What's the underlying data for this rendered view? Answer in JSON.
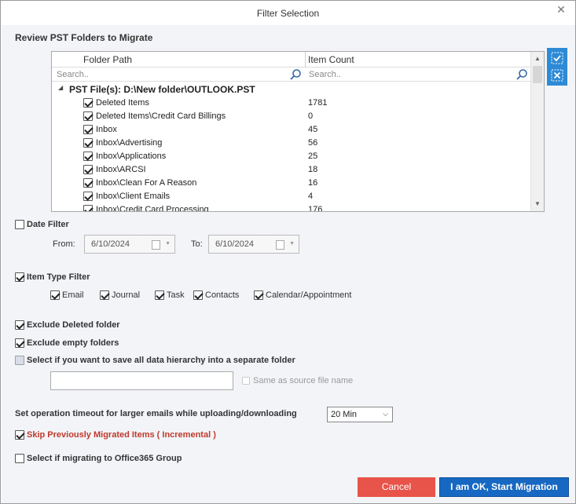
{
  "window": {
    "title": "Filter Selection",
    "close_glyph": "✕"
  },
  "review": {
    "title": "Review PST Folders to Migrate",
    "columns": {
      "path": "Folder Path",
      "count": "Item Count"
    },
    "search_placeholder_path": "Search..",
    "search_placeholder_count": "Search..",
    "group_label": "PST File(s): D:\\New folder\\OUTLOOK.PST",
    "rows": [
      {
        "path": "Deleted Items",
        "count": "1781",
        "checked": true
      },
      {
        "path": "Deleted Items\\Credit Card Billings",
        "count": "0",
        "checked": true
      },
      {
        "path": "Inbox",
        "count": "45",
        "checked": true
      },
      {
        "path": "Inbox\\Advertising",
        "count": "56",
        "checked": true
      },
      {
        "path": "Inbox\\Applications",
        "count": "25",
        "checked": true
      },
      {
        "path": "Inbox\\ARCSI",
        "count": "18",
        "checked": true
      },
      {
        "path": "Inbox\\Clean For A Reason",
        "count": "16",
        "checked": true
      },
      {
        "path": "Inbox\\Client Emails",
        "count": "4",
        "checked": true
      },
      {
        "path": "Inbox\\Credit Card Processing",
        "count": "176",
        "checked": true
      }
    ]
  },
  "date_filter": {
    "label": "Date Filter",
    "checked": false,
    "from_label": "From:",
    "from_value": "6/10/2024",
    "to_label": "To:",
    "to_value": "6/10/2024"
  },
  "item_type_filter": {
    "label": "Item Type Filter",
    "checked": true,
    "types": [
      {
        "label": "Email",
        "checked": true
      },
      {
        "label": "Journal",
        "checked": true
      },
      {
        "label": "Task",
        "checked": true
      },
      {
        "label": "Contacts",
        "checked": true
      },
      {
        "label": "Calendar/Appointment",
        "checked": true
      }
    ]
  },
  "options": {
    "exclude_deleted": {
      "label": "Exclude Deleted folder",
      "checked": true
    },
    "exclude_empty": {
      "label": "Exclude empty folders",
      "checked": true
    },
    "save_hierarchy": {
      "label": "Select if you want to save all data hierarchy into a separate folder",
      "checked": false
    },
    "folder_name_value": "",
    "same_as_source": {
      "label": "Same as source file name",
      "checked": false
    }
  },
  "timeout": {
    "label": "Set operation timeout for larger emails while uploading/downloading",
    "value": "20 Min"
  },
  "skip_migrated": {
    "label": "Skip Previously Migrated Items ( Incremental )",
    "checked": true
  },
  "office365_group": {
    "label": "Select if migrating to Office365 Group",
    "checked": false
  },
  "buttons": {
    "cancel": "Cancel",
    "ok": "I am OK, Start Migration"
  },
  "colors": {
    "accent": "#2d8ad6",
    "cancel": "#e8534a",
    "primary": "#1668c2",
    "warning_text": "#c0392b"
  }
}
